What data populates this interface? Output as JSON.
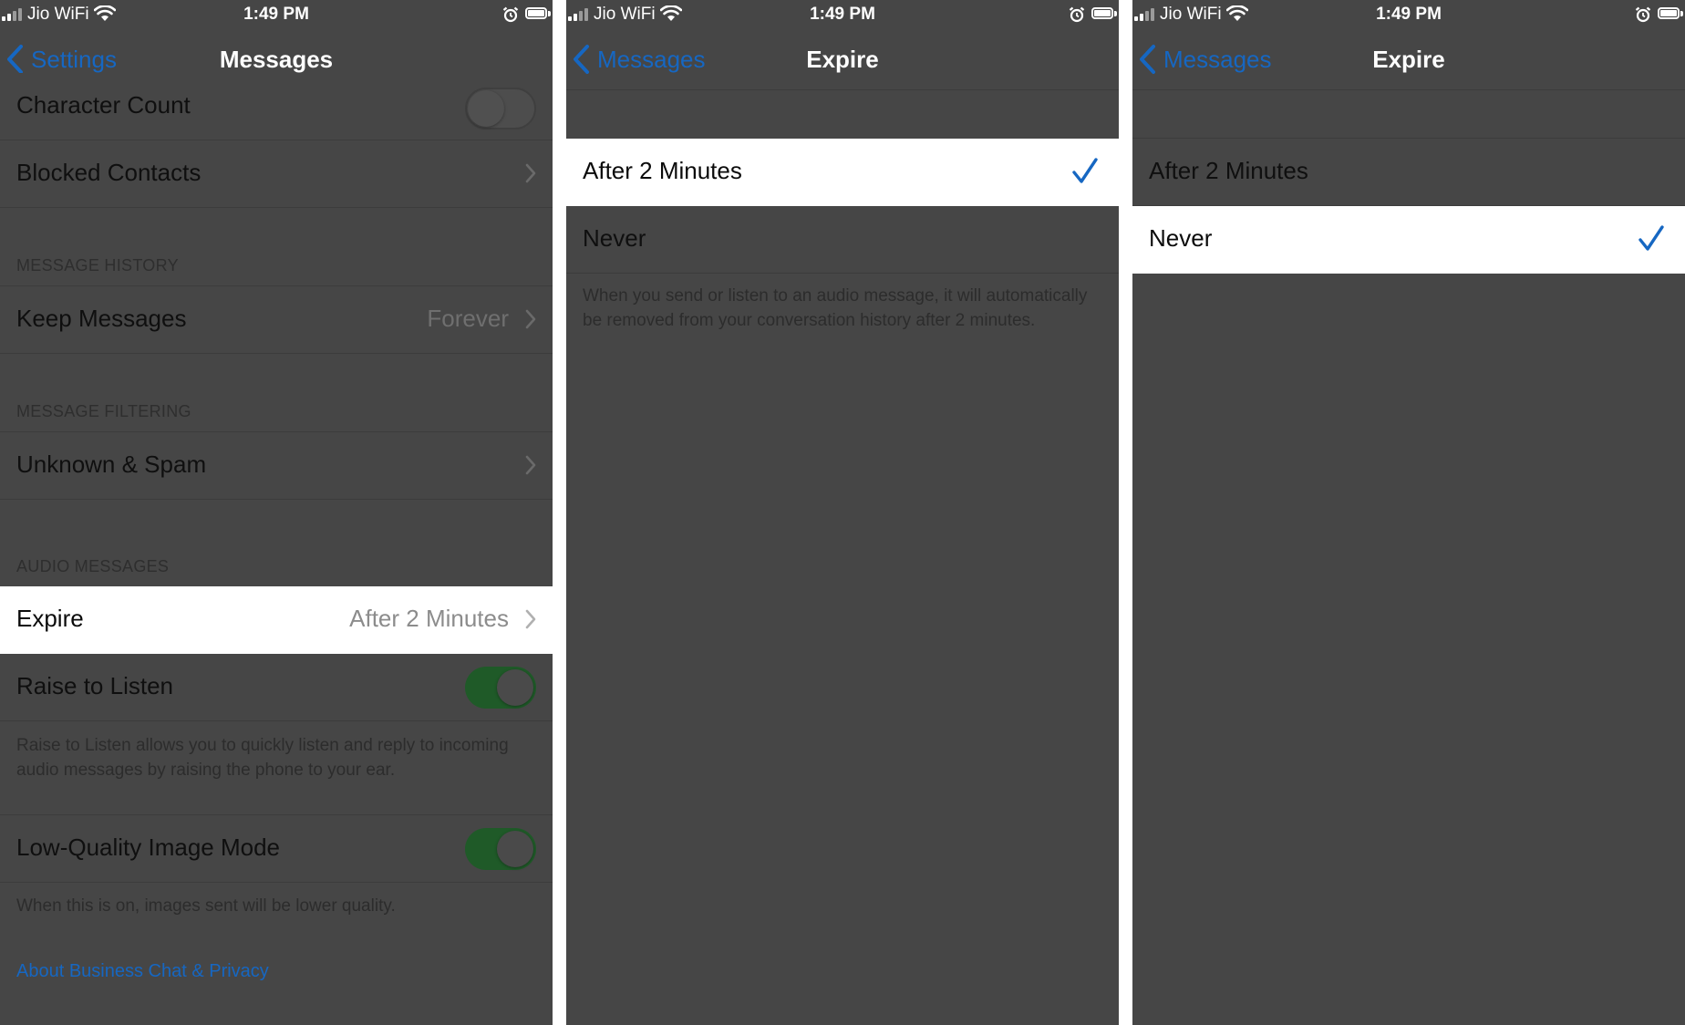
{
  "status_bar": {
    "carrier": "Jio WiFi",
    "time": "1:49 PM"
  },
  "colors": {
    "accent": "#1667c2",
    "toggle_on": "#1f5a28",
    "background": "#464646",
    "selected_row": "#ffffff"
  },
  "screens": [
    {
      "back_label": "Settings",
      "title": "Messages",
      "rows": {
        "character_count": {
          "label": "Character Count",
          "toggle": "off"
        },
        "blocked_contacts": {
          "label": "Blocked Contacts"
        },
        "keep_messages": {
          "label": "Keep Messages",
          "value": "Forever"
        },
        "unknown_spam": {
          "label": "Unknown & Spam"
        },
        "expire": {
          "label": "Expire",
          "value": "After 2 Minutes",
          "highlighted": true
        },
        "raise_to_listen": {
          "label": "Raise to Listen",
          "toggle": "on"
        },
        "low_quality": {
          "label": "Low-Quality Image Mode",
          "toggle": "on"
        }
      },
      "sections": {
        "message_history": "MESSAGE HISTORY",
        "message_filtering": "MESSAGE FILTERING",
        "audio_messages": "AUDIO MESSAGES"
      },
      "footnotes": {
        "raise_to_listen": "Raise to Listen allows you to quickly listen and reply to incoming audio messages by raising the phone to your ear.",
        "low_quality": "When this is on, images sent will be lower quality."
      },
      "link": "About Business Chat & Privacy"
    },
    {
      "back_label": "Messages",
      "title": "Expire",
      "options": [
        {
          "label": "After 2 Minutes",
          "selected": true
        },
        {
          "label": "Never",
          "selected": false
        }
      ],
      "footnote": "When you send or listen to an audio message, it will automatically be removed from your conversation history after 2 minutes."
    },
    {
      "back_label": "Messages",
      "title": "Expire",
      "options": [
        {
          "label": "After 2 Minutes",
          "selected": false
        },
        {
          "label": "Never",
          "selected": true
        }
      ]
    }
  ]
}
